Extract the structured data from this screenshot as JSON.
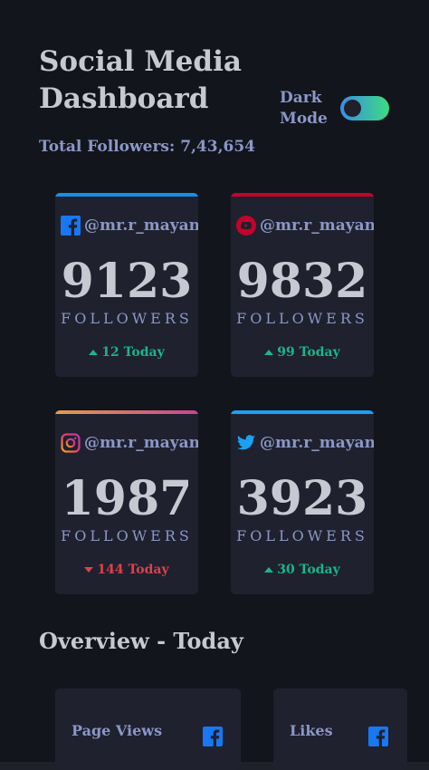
{
  "header": {
    "title": "Social Media Dashboard",
    "total_followers": "Total Followers: 7,43,654",
    "dark_mode_label": "Dark Mode",
    "dark_mode_on": true
  },
  "platforms": [
    {
      "name": "facebook",
      "handle": "@mr.r_mayank",
      "count": "9123",
      "label": "FOLLOWERS",
      "today": "12 Today",
      "trend": "up",
      "accent": "#178fe6"
    },
    {
      "name": "youtube",
      "handle": "@mr.r_mayank",
      "count": "9832",
      "label": "FOLLOWERS",
      "today": "99 Today",
      "trend": "up",
      "accent": "#c4032b"
    },
    {
      "name": "instagram",
      "handle": "@mr.r_mayank",
      "count": "1987",
      "label": "FOLLOWERS",
      "today": "144 Today",
      "trend": "down",
      "accent": "#df9e4e"
    },
    {
      "name": "twitter",
      "handle": "@mr.r_mayank",
      "count": "3923",
      "label": "FOLLOWERS",
      "today": "30 Today",
      "trend": "up",
      "accent": "#1ca0f2"
    }
  ],
  "overview": {
    "title": "Overview - Today",
    "cards": [
      {
        "label": "Page Views",
        "icon": "facebook-icon"
      },
      {
        "label": "Likes",
        "icon": "facebook-icon"
      }
    ]
  },
  "colors": {
    "background": "#13151d",
    "card": "#1f212e",
    "text_primary": "#c7c8d1",
    "text_secondary": "#8b97c6",
    "trend_up": "#1db489",
    "trend_down": "#dc414c"
  }
}
